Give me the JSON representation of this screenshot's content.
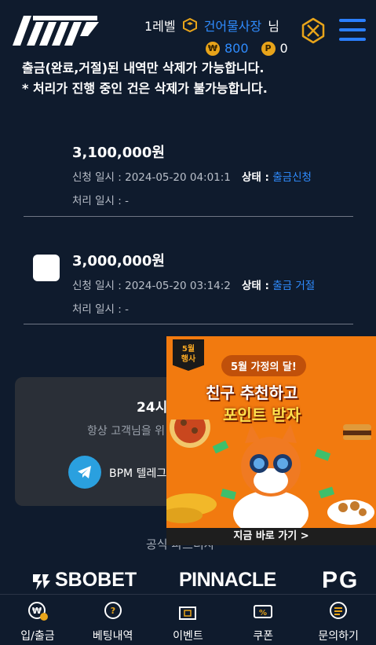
{
  "header": {
    "level": "1레벨",
    "nickname": "건어물사장",
    "honorific": "님",
    "money": "800",
    "money_icon": "₩",
    "points": "0",
    "point_icon": "P"
  },
  "notice": {
    "line1": "출금(완료,거절)된 내역만 삭제가 가능합니다.",
    "line2": "* 처리가 진행 중인 건은 삭제가 불가능합니다."
  },
  "entries": [
    {
      "amount": "3,100,000원",
      "request_time": "신청 일시 : 2024-05-20 04:01:1",
      "status_label": "상태 :",
      "status_value": "출금신청",
      "process_time": "처리 일시 : -"
    },
    {
      "amount": "3,000,000원",
      "request_time": "신청 일시 : 2024-05-20 03:14:2",
      "status_label": "상태 :",
      "status_value": "출금 거절",
      "process_time": "처리 일시 : -"
    }
  ],
  "support": {
    "title": "24시",
    "subtitle": "항상 고객님을 위",
    "telegram_label": "BPM 텔레그"
  },
  "partners": {
    "title": "공식 파트너사",
    "logos": [
      "SBOBET",
      "PINNACLE",
      "PG"
    ]
  },
  "bottom_nav": [
    {
      "label": "입/출금",
      "icon": "wallet-icon"
    },
    {
      "label": "베팅내역",
      "icon": "bet-history-icon"
    },
    {
      "label": "이벤트",
      "icon": "gift-icon"
    },
    {
      "label": "쿠폰",
      "icon": "coupon-icon"
    },
    {
      "label": "문의하기",
      "icon": "chat-icon"
    }
  ],
  "promo": {
    "badge": "5월\n행사",
    "tag": "5월 가정의 달!",
    "headline1": "친구 추천하고",
    "headline2": "포인트 받자",
    "cta": "지금 바로 가기 >"
  },
  "colors": {
    "background": "#0f1b2d",
    "accent_blue": "#2f8cff",
    "promo_orange": "#f27a0f",
    "coin_gold": "#e8a41a"
  }
}
